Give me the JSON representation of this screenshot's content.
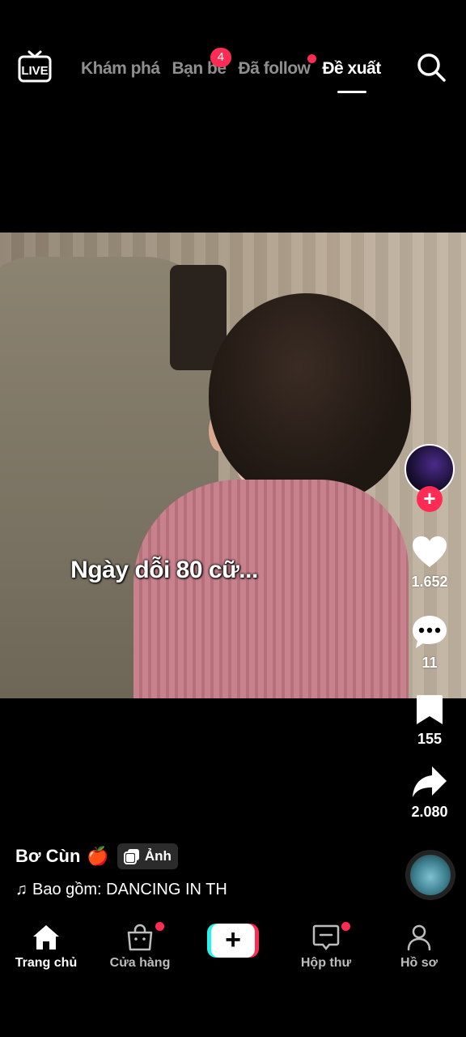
{
  "header": {
    "live_label": "LIVE",
    "tabs": [
      {
        "label": "Khám phá",
        "active": false
      },
      {
        "label": "Bạn bè",
        "active": false,
        "badge": "4"
      },
      {
        "label": "Đã follow",
        "active": false,
        "dot": true
      },
      {
        "label": "Đề xuất",
        "active": true
      }
    ],
    "search_icon": "search-icon"
  },
  "video": {
    "caption": "Ngày dỗi 80 cữ..."
  },
  "actions": {
    "likes": "1.652",
    "comments": "11",
    "saves": "155",
    "shares": "2.080"
  },
  "post": {
    "author": "Bơ Cùn",
    "emoji": "🍎",
    "type_label": "Ảnh",
    "music_prefix": "♫",
    "music": "Bao gồm: DANCING IN TH"
  },
  "bottom_nav": {
    "items": [
      {
        "label": "Trang chủ",
        "icon": "home-icon",
        "active": true
      },
      {
        "label": "Cửa hàng",
        "icon": "shop-icon",
        "dot": true
      },
      {
        "label": "",
        "icon": "create-plus-icon"
      },
      {
        "label": "Hộp thư",
        "icon": "inbox-icon",
        "dot": true
      },
      {
        "label": "Hồ sơ",
        "icon": "profile-icon"
      }
    ]
  },
  "colors": {
    "accent": "#fe2c55",
    "accent_cyan": "#25f4ee",
    "inactive_tab": "#8f8f8f"
  }
}
